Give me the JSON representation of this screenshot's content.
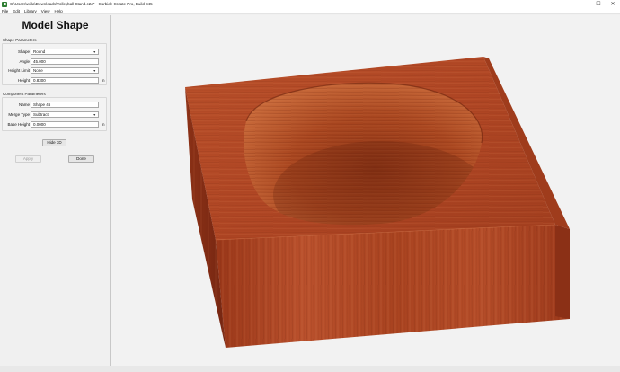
{
  "window": {
    "title": "C:\\Users\\willa\\Downloads\\Volleyball Stand.c2d* - Carbide Create Pro, Build 845",
    "minimize": "—",
    "maximize": "☐",
    "close": "✕"
  },
  "menu": [
    "File",
    "Edit",
    "Library",
    "View",
    "Help"
  ],
  "panel": {
    "title": "Model Shape",
    "shape_params_label": "Shape Parameters",
    "shape": {
      "label": "Shape",
      "value": "Round"
    },
    "angle": {
      "label": "Angle",
      "value": "45.000"
    },
    "height_limit": {
      "label": "Height Limit",
      "value": "None"
    },
    "height": {
      "label": "Height",
      "value": "0.8300",
      "unit": "in"
    },
    "component_params_label": "Component Parameters",
    "name": {
      "label": "Name",
      "value": "Shape 46"
    },
    "merge_type": {
      "label": "Merge Type",
      "value": "Subtract"
    },
    "base_height": {
      "label": "Base Height",
      "value": "0.0000",
      "unit": "in"
    },
    "hide3d_label": "Hide 3D",
    "apply_label": "Apply",
    "done_label": "Done"
  },
  "colors": {
    "wood_top": "#b34a26",
    "wood_front": "#a8401f",
    "wood_side": "#8f3217",
    "bowl_light": "#c96a3a",
    "bowl_dark": "#7e2c12"
  }
}
